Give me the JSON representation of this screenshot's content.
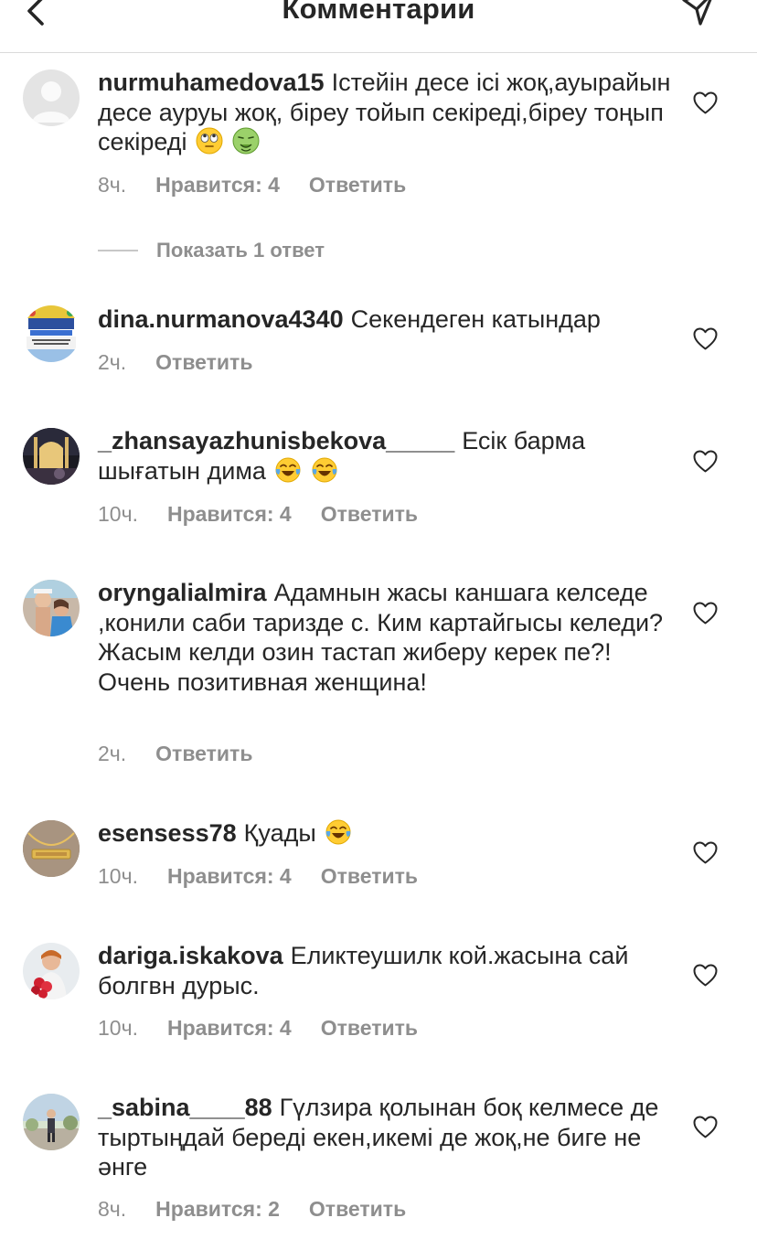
{
  "header": {
    "title": "Комментарии",
    "back_icon": "chevron-left-icon",
    "send_icon": "paper-plane-icon"
  },
  "show_replies": "Показать 1 ответ",
  "comments": [
    {
      "username": "nurmuhamedova15",
      "text": "Істейін десе ісі жоқ,ауырайын  десе ауруы жоқ, біреу тойып секіреді,біреу тоңып секіреді",
      "emoji": [
        "face-with-rolling-eyes",
        "nauseated-face"
      ],
      "time": "8ч.",
      "likes": "Нравится: 4",
      "reply": "Ответить"
    },
    {
      "username": "dina.nurmanova4340",
      "text": "Секендеген катындар",
      "emoji": [],
      "time": "2ч.",
      "likes": "",
      "reply": "Ответить"
    },
    {
      "username": "_zhansayazhunisbekova_____",
      "text": "Есік барма шығатын дима",
      "emoji": [
        "tears-of-joy",
        "tears-of-joy"
      ],
      "time": "10ч.",
      "likes": "Нравится: 4",
      "reply": "Ответить"
    },
    {
      "username": "oryngalialmira",
      "text": "Адамнын жасы  каншага келседе ,конили саби таризде с. Ким картайгысы келеди?Жасым келди озин тастап жиберу керек пе?!Очень  позитивная женщина!",
      "emoji": [],
      "time": "2ч.",
      "likes": "",
      "reply": "Ответить"
    },
    {
      "username": "esensess78",
      "text": "Қуады",
      "emoji": [
        "tears-of-joy"
      ],
      "time": "10ч.",
      "likes": "Нравится: 4",
      "reply": "Ответить"
    },
    {
      "username": "dariga.iskakova",
      "text": "Еликтеушилк кой.жасына сай болгвн дурыс.",
      "emoji": [],
      "time": "10ч.",
      "likes": "Нравится: 4",
      "reply": "Ответить"
    },
    {
      "username": "_sabina____88",
      "text": "Гүлзира қолынан боқ келмесе де тыртыңдай береді екен,икемі де жоқ,не биге не әнге",
      "emoji": [],
      "time": "8ч.",
      "likes": "Нравится: 2",
      "reply": "Ответить"
    }
  ]
}
